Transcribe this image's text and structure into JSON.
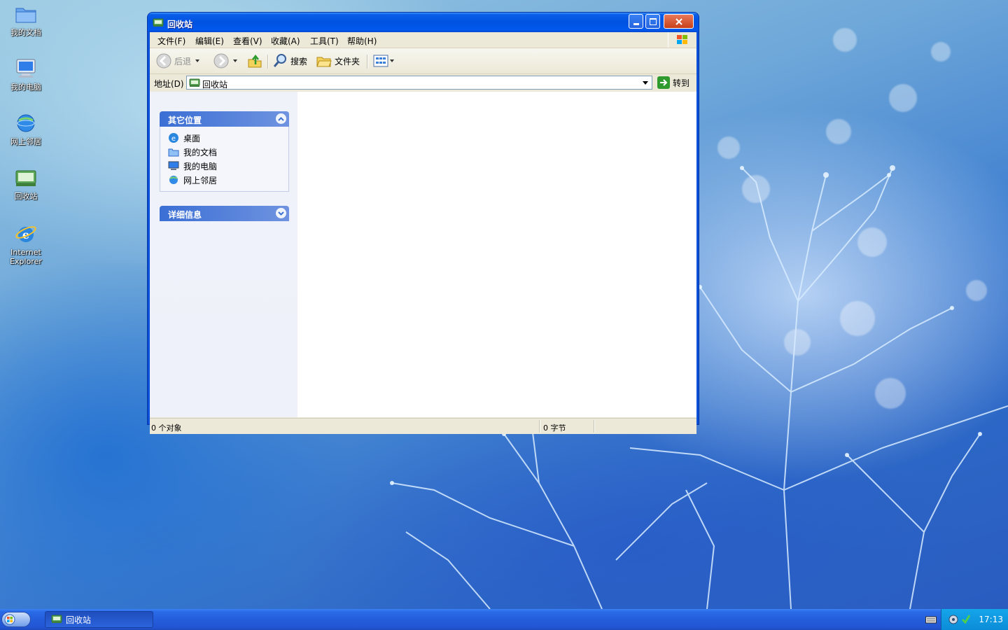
{
  "desktop": {
    "icons": [
      {
        "label": "我的文档",
        "icon": "my-documents-icon"
      },
      {
        "label": "我的电脑",
        "icon": "my-computer-icon"
      },
      {
        "label": "网上邻居",
        "icon": "network-icon"
      },
      {
        "label": "回收站",
        "icon": "recycle-bin-icon"
      },
      {
        "label": "Internet Explorer",
        "icon": "internet-explorer-icon"
      }
    ]
  },
  "window": {
    "title": "回收站",
    "menu": [
      "文件(F)",
      "编辑(E)",
      "查看(V)",
      "收藏(A)",
      "工具(T)",
      "帮助(H)"
    ],
    "toolbar": {
      "back": "后退",
      "search": "搜索",
      "folders": "文件夹"
    },
    "address": {
      "label": "地址(D)",
      "value": "回收站",
      "go": "转到"
    },
    "taskpane": {
      "other_places": {
        "title": "其它位置",
        "links": [
          "桌面",
          "我的文档",
          "我的电脑",
          "网上邻居"
        ]
      },
      "details": {
        "title": "详细信息"
      }
    },
    "status": {
      "objects": "0 个对象",
      "size": "0 字节"
    }
  },
  "taskbar": {
    "task": "回收站",
    "clock": "17:13"
  },
  "colors": {
    "title_blue": "#0053e1",
    "taskbar_blue": "#245edb",
    "tray_blue": "#0c8cd8",
    "window_bg": "#ece9d8"
  }
}
